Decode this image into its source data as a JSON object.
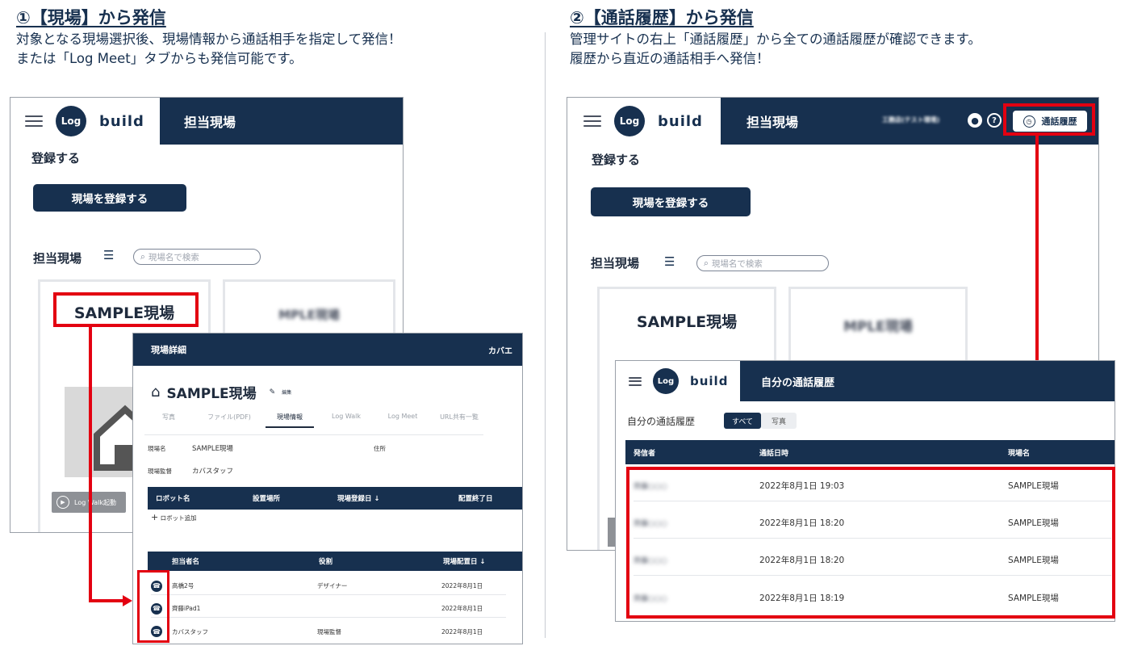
{
  "left": {
    "heading": "①【現場】から発信",
    "desc_line1": "対象となる現場選択後、現場情報から通話相手を指定して発信！",
    "desc_line2": "または「Log Meet」タブからも発信可能です。",
    "app": {
      "logo_text": "build",
      "logo_mark": "Log",
      "nav_title": "担当現場",
      "register_label": "登録する",
      "register_button": "現場を登録する",
      "list_label": "担当現場",
      "search_placeholder": "現場名で検索",
      "card1_title": "SAMPLE現場",
      "card2_title": "MPLE現場",
      "logwalk_button": "Log Walk起動"
    },
    "detail": {
      "header_title": "現場詳細",
      "header_right": "カバエ",
      "site_title": "SAMPLE現場",
      "edit_label": "編集",
      "tabs": [
        "写真",
        "ファイル(PDF)",
        "現場情報",
        "Log Walk",
        "Log Meet",
        "URL共有一覧"
      ],
      "info_site_label": "現場名",
      "info_site_value": "SAMPLE現場",
      "info_addr_label": "住所",
      "info_manager_label": "現場監督",
      "info_manager_value": "カバスタッフ",
      "robot_headers": [
        "ロボット名",
        "設置場所",
        "現場登録日 ↓",
        "配置終了日"
      ],
      "add_robot": "ロボット追加",
      "staff_headers": [
        "担当者名",
        "役割",
        "現場配置日 ↓"
      ],
      "staff_rows": [
        {
          "name": "高橋2号",
          "role": "デザイナー",
          "date": "2022年8月1日"
        },
        {
          "name": "齊藤iPad1",
          "role": "",
          "date": "2022年8月1日"
        },
        {
          "name": "カバスタッフ",
          "role": "現場監督",
          "date": "2022年8月1日"
        }
      ]
    }
  },
  "right": {
    "heading": "②【通話履歴】から発信",
    "desc_line1": "管理サイトの右上「通話履歴」から全ての通話履歴が確認できます。",
    "desc_line2": "履歴から直近の通話相手へ発信！",
    "app": {
      "logo_text": "build",
      "logo_mark": "Log",
      "nav_title": "担当現場",
      "company_blur": "工務店(テスト環境)",
      "history_button": "通話履歴",
      "register_label": "登録する",
      "register_button": "現場を登録する",
      "list_label": "担当現場",
      "search_placeholder": "現場名で検索",
      "card1_title": "SAMPLE現場",
      "card2_title": "MPLE現場"
    },
    "history": {
      "nav_title": "自分の通話履歴",
      "page_label": "自分の通話履歴",
      "filter_all": "すべて",
      "filter_photo": "写真",
      "headers": [
        "発信者",
        "通話日時",
        "現場名"
      ],
      "rows": [
        {
          "caller": "齊藤○○○",
          "datetime": "2022年8月1日 19:03",
          "site": "SAMPLE現場"
        },
        {
          "caller": "齊藤○○○",
          "datetime": "2022年8月1日 18:20",
          "site": "SAMPLE現場"
        },
        {
          "caller": "齊藤○○○",
          "datetime": "2022年8月1日 18:20",
          "site": "SAMPLE現場"
        },
        {
          "caller": "齊藤○○○",
          "datetime": "2022年8月1日 18:19",
          "site": "SAMPLE現場"
        }
      ]
    }
  },
  "colors": {
    "navy": "#17304f",
    "highlight": "#e30011"
  }
}
